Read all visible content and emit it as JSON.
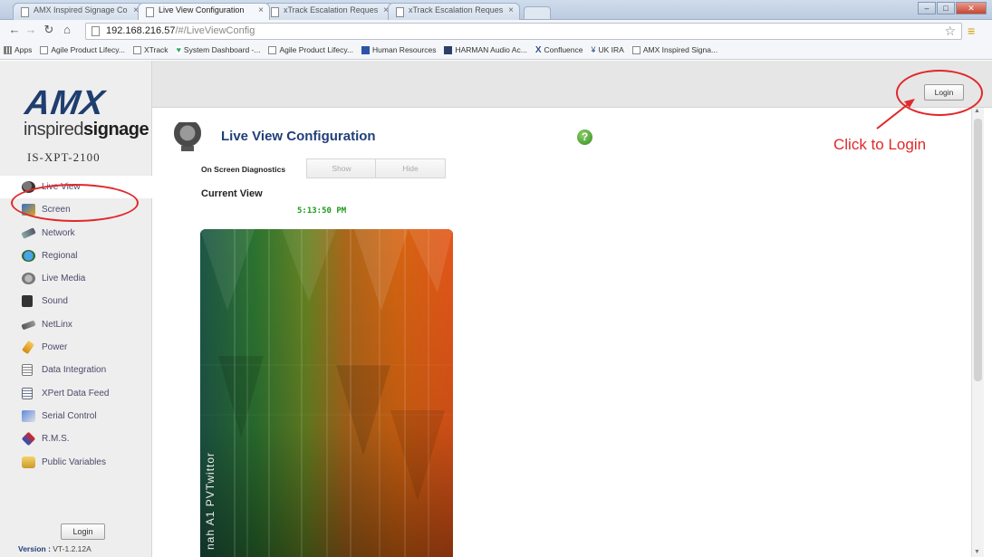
{
  "browser": {
    "tabs": [
      {
        "label": "AMX Inspired Signage Co",
        "active": false
      },
      {
        "label": "Live View Configuration",
        "active": true
      },
      {
        "label": "xTrack Escalation Reques",
        "active": false
      },
      {
        "label": "xTrack Escalation Reques",
        "active": false
      }
    ],
    "address": {
      "host": "192.168.216.57",
      "path": "/#/LiveViewConfig"
    },
    "bookmarks": [
      {
        "label": "Apps",
        "icon": "grid-icon"
      },
      {
        "label": "Agile Product Lifecy...",
        "icon": "page-icon"
      },
      {
        "label": "XTrack",
        "icon": "page-icon"
      },
      {
        "label": "System Dashboard -...",
        "icon": "dashboard-icon"
      },
      {
        "label": "Agile Product Lifecy...",
        "icon": "page-icon"
      },
      {
        "label": "Human Resources",
        "icon": "hr-icon"
      },
      {
        "label": "HARMAN Audio Ac...",
        "icon": "harman-icon"
      },
      {
        "label": "Confluence",
        "icon": "confluence-icon"
      },
      {
        "label": "UK IRA",
        "icon": "ira-icon"
      },
      {
        "label": "AMX Inspired Signa...",
        "icon": "page-icon"
      }
    ]
  },
  "sidebar": {
    "logo": {
      "brand": "AMX",
      "sub_light": "inspired",
      "sub_bold": "signage"
    },
    "device": "IS-XPT-2100",
    "items": [
      {
        "label": "Live View",
        "icon": "camera-icon",
        "current": true
      },
      {
        "label": "Screen",
        "icon": "screen-icon",
        "current": false
      },
      {
        "label": "Network",
        "icon": "network-icon",
        "current": false
      },
      {
        "label": "Regional",
        "icon": "globe-icon",
        "current": false
      },
      {
        "label": "Live Media",
        "icon": "live-media-icon",
        "current": false
      },
      {
        "label": "Sound",
        "icon": "speaker-icon",
        "current": false
      },
      {
        "label": "NetLinx",
        "icon": "netlinx-icon",
        "current": false
      },
      {
        "label": "Power",
        "icon": "power-icon",
        "current": false
      },
      {
        "label": "Data Integration",
        "icon": "data-integration-icon",
        "current": false
      },
      {
        "label": "XPert Data Feed",
        "icon": "data-feed-icon",
        "current": false
      },
      {
        "label": "Serial Control",
        "icon": "serial-control-icon",
        "current": false
      },
      {
        "label": "R.M.S.",
        "icon": "rms-icon",
        "current": false
      },
      {
        "label": "Public Variables",
        "icon": "public-variables-icon",
        "current": false
      }
    ],
    "login_label": "Login",
    "version_label": "Version : ",
    "version_value": "VT-1.2.12A"
  },
  "header": {
    "login_label": "Login"
  },
  "main": {
    "title": "Live View Configuration",
    "osd_label": "On Screen Diagnostics",
    "show_label": "Show",
    "hide_label": "Hide",
    "current_view_label": "Current View",
    "clock": "5:13:50 PM",
    "preview_text": "nah A1 PVTwittor"
  },
  "annotation": {
    "text": "Click to Login",
    "color": "#e0282a"
  },
  "colors": {
    "title": "#213f7a",
    "clock": "#1e9a1e",
    "sidebar_bg": "#eeeeee"
  }
}
